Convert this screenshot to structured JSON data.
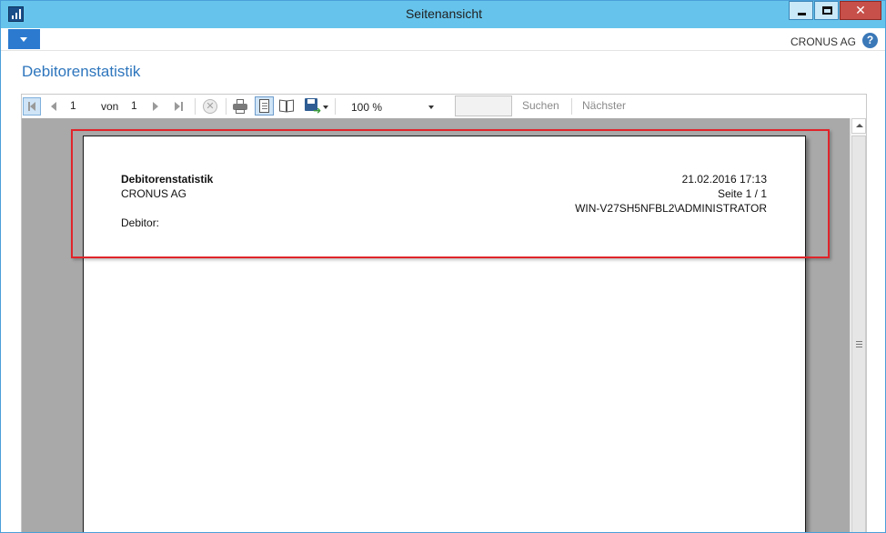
{
  "window": {
    "title": "Seitenansicht",
    "close_glyph": "✕"
  },
  "ribbon": {
    "company": "CRONUS AG",
    "help_glyph": "?"
  },
  "page": {
    "title": "Debitorenstatistik"
  },
  "toolbar": {
    "current_page": "1",
    "of_label": "von",
    "total_pages": "1",
    "zoom": "100 %",
    "search_value": "",
    "search_label": "Suchen",
    "next_label": "Nächster",
    "stop_glyph": "✕"
  },
  "report": {
    "title": "Debitorenstatistik",
    "company": "CRONUS AG",
    "customer_label": "Debitor:",
    "datetime": "21.02.2016 17:13",
    "page_info": "Seite 1 / 1",
    "user": "WIN-V27SH5NFBL2\\ADMINISTRATOR"
  },
  "colors": {
    "title_bar": "#66c4ec",
    "accent_blue": "#2e76bd",
    "close_button": "#c7504a",
    "highlight_border": "#e0242a",
    "viewer_background": "#a9a9a9"
  }
}
